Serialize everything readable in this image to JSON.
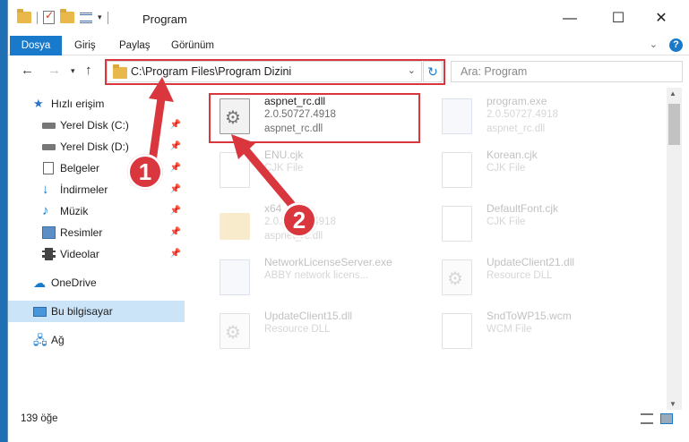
{
  "window": {
    "title": "Program",
    "controls": {
      "minimize": "—",
      "maximize": "☐",
      "close": "✕"
    }
  },
  "ribbon": {
    "tabs": [
      "Dosya",
      "Giriş",
      "Paylaş",
      "Görünüm"
    ],
    "help": "?"
  },
  "nav": {
    "address": "C:\\Program Files\\Program Dizini",
    "search_placeholder": "Ara: Program"
  },
  "sidebar": {
    "items": [
      {
        "label": "Hızlı erişim",
        "icon": "star-icon"
      },
      {
        "label": "Yerel Disk (C:)",
        "icon": "disk-icon",
        "pinned": true
      },
      {
        "label": "Yerel Disk (D:)",
        "icon": "disk-icon",
        "pinned": true
      },
      {
        "label": "Belgeler",
        "icon": "documents-icon",
        "pinned": true
      },
      {
        "label": "İndirmeler",
        "icon": "downloads-icon",
        "pinned": true
      },
      {
        "label": "Müzik",
        "icon": "music-icon",
        "pinned": true
      },
      {
        "label": "Resimler",
        "icon": "pictures-icon",
        "pinned": true
      },
      {
        "label": "Videolar",
        "icon": "videos-icon",
        "pinned": true
      },
      {
        "label": "OneDrive",
        "icon": "cloud-icon"
      },
      {
        "label": "Bu bilgisayar",
        "icon": "computer-icon",
        "selected": true
      },
      {
        "label": "Ağ",
        "icon": "network-icon"
      }
    ]
  },
  "files": [
    {
      "name": "aspnet_rc.dll",
      "line2": "2.0.50727.4918",
      "line3": "aspnet_rc.dll",
      "icon": "dll-icon",
      "highlighted": true
    },
    {
      "name": "program.exe",
      "line2": "2.0.50727.4918",
      "line3": "aspnet_rc.dll",
      "icon": "exe-icon"
    },
    {
      "name": "ENU.cjk",
      "line2": "CJK File",
      "line3": "",
      "icon": "file-icon"
    },
    {
      "name": "Korean.cjk",
      "line2": "CJK File",
      "line3": "",
      "icon": "file-icon"
    },
    {
      "name": "x64",
      "line2": "2.0.50727.4918",
      "line3": "aspnet_rc.dll",
      "icon": "folder-icon"
    },
    {
      "name": "DefaultFont.cjk",
      "line2": "CJK File",
      "line3": "",
      "icon": "file-icon"
    },
    {
      "name": "NetworkLicenseServer.exe",
      "line2": "ABBY network licens...",
      "line3": "",
      "icon": "exe-icon"
    },
    {
      "name": "UpdateClient21.dll",
      "line2": "Resource DLL",
      "line3": "",
      "icon": "dll-icon"
    },
    {
      "name": "UpdateClient15.dll",
      "line2": "Resource DLL",
      "line3": "",
      "icon": "dll-icon"
    },
    {
      "name": "SndToWP15.wcm",
      "line2": "WCM File",
      "line3": "",
      "icon": "file-icon"
    }
  ],
  "status": {
    "count": "139 öğe"
  },
  "annotations": {
    "step1": "1",
    "step2": "2"
  },
  "colors": {
    "accent": "#1979ca",
    "highlight": "#d9363e",
    "selected": "#cce4f7"
  }
}
